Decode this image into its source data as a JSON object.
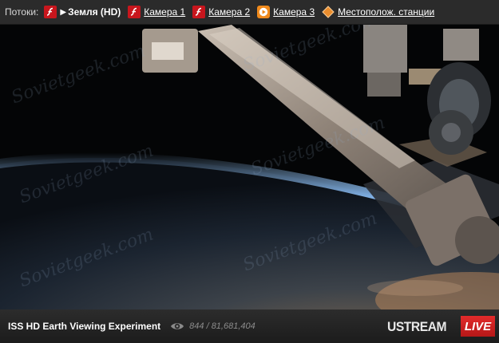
{
  "streams_bar": {
    "label": "Потоки:",
    "items": [
      {
        "name": "Земля (HD)",
        "icon": "flash-icon",
        "active": true
      },
      {
        "name": "Камера 1",
        "icon": "flash-icon",
        "active": false
      },
      {
        "name": "Камера 2",
        "icon": "flash-icon",
        "active": false
      },
      {
        "name": "Камера 3",
        "icon": "play-icon",
        "active": false
      },
      {
        "name": "Местополож. станции",
        "icon": "diamond-location-icon",
        "active": false
      }
    ]
  },
  "video": {
    "watermark": "Sovietgeek.com"
  },
  "player_bar": {
    "title": "ISS HD Earth Viewing Experiment",
    "viewers": "844 / 81,681,404",
    "brand": "USTREAM",
    "live_badge": "LIVE"
  },
  "colors": {
    "flash_red": "#c8161d",
    "play_orange": "#f08a1c",
    "diamond_orange": "#e98d2e",
    "live_red": "#d42222"
  }
}
